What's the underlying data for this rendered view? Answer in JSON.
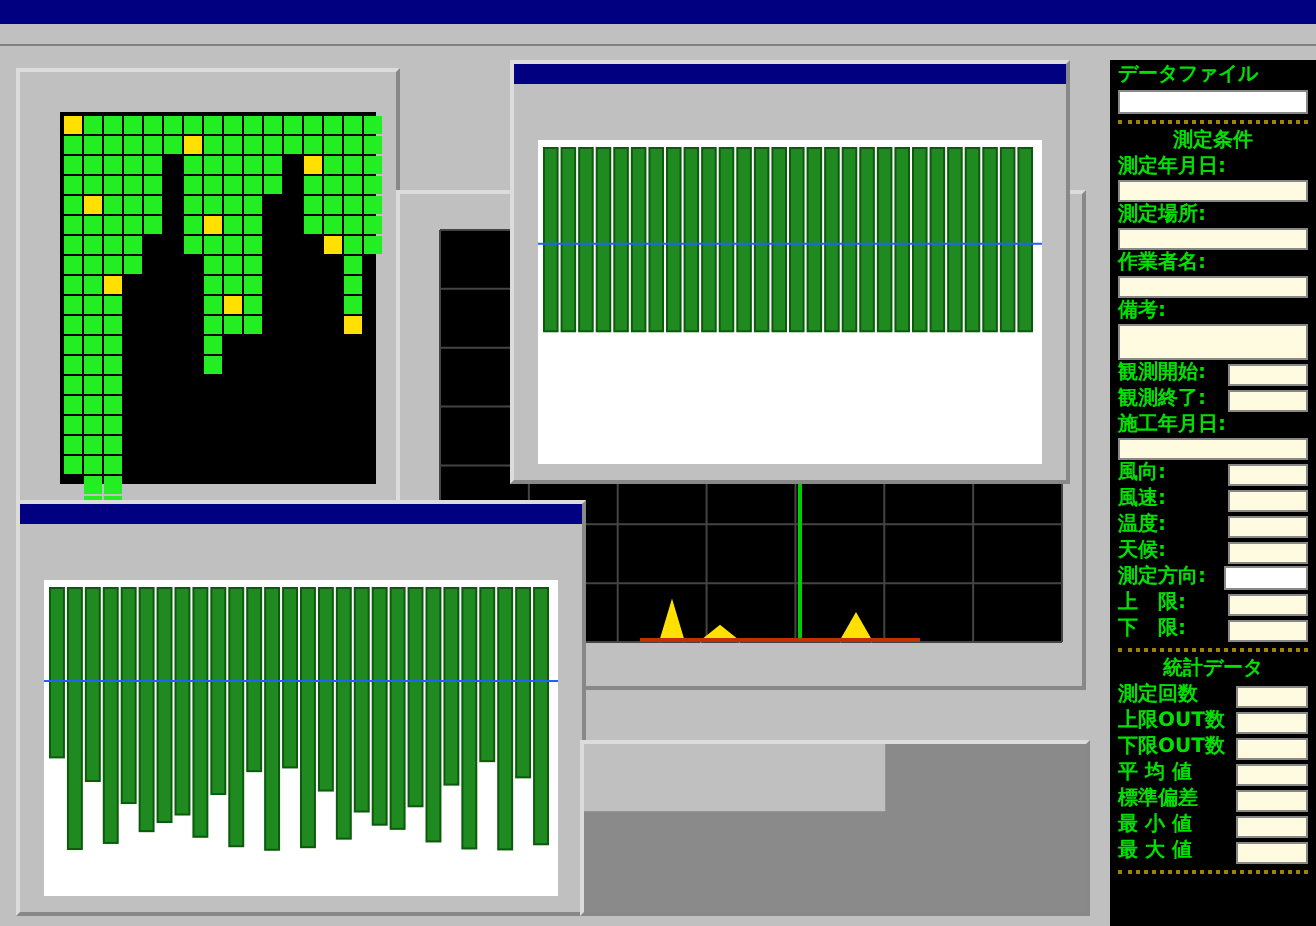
{
  "data_file": {
    "label": "データファイル"
  },
  "conditions": {
    "heading": "測定条件",
    "items": [
      {
        "kind": "block",
        "label": "測定年月日:"
      },
      {
        "kind": "block",
        "label": "測定場所:"
      },
      {
        "kind": "block",
        "label": "作業者名:"
      },
      {
        "kind": "area",
        "label": "備考:"
      },
      {
        "kind": "inline",
        "label": "観測開始:"
      },
      {
        "kind": "inline",
        "label": "観測終了:"
      },
      {
        "kind": "block",
        "label": "施工年月日:"
      },
      {
        "kind": "inline",
        "label": "風向:"
      },
      {
        "kind": "inline",
        "label": "風速:"
      },
      {
        "kind": "inline",
        "label": "温度:"
      },
      {
        "kind": "inline",
        "label": "天候:"
      },
      {
        "kind": "select",
        "label": "測定方向:"
      },
      {
        "kind": "inline",
        "label": "上　限:"
      },
      {
        "kind": "inline",
        "label": "下　限:"
      }
    ]
  },
  "statistics": {
    "heading": "統計データ",
    "items": [
      {
        "label": "測定回数"
      },
      {
        "label": "上限OUT数"
      },
      {
        "label": "下限OUT数"
      },
      {
        "label": "平 均 値"
      },
      {
        "label": "標準偏差"
      },
      {
        "label": "最 小 値"
      },
      {
        "label": "最 大 値"
      }
    ]
  },
  "panes": [
    {
      "kind": "heatmap"
    },
    {
      "kind": "scope"
    },
    {
      "kind": "bars"
    },
    {
      "kind": "bars"
    },
    {
      "kind": "blank"
    }
  ]
}
